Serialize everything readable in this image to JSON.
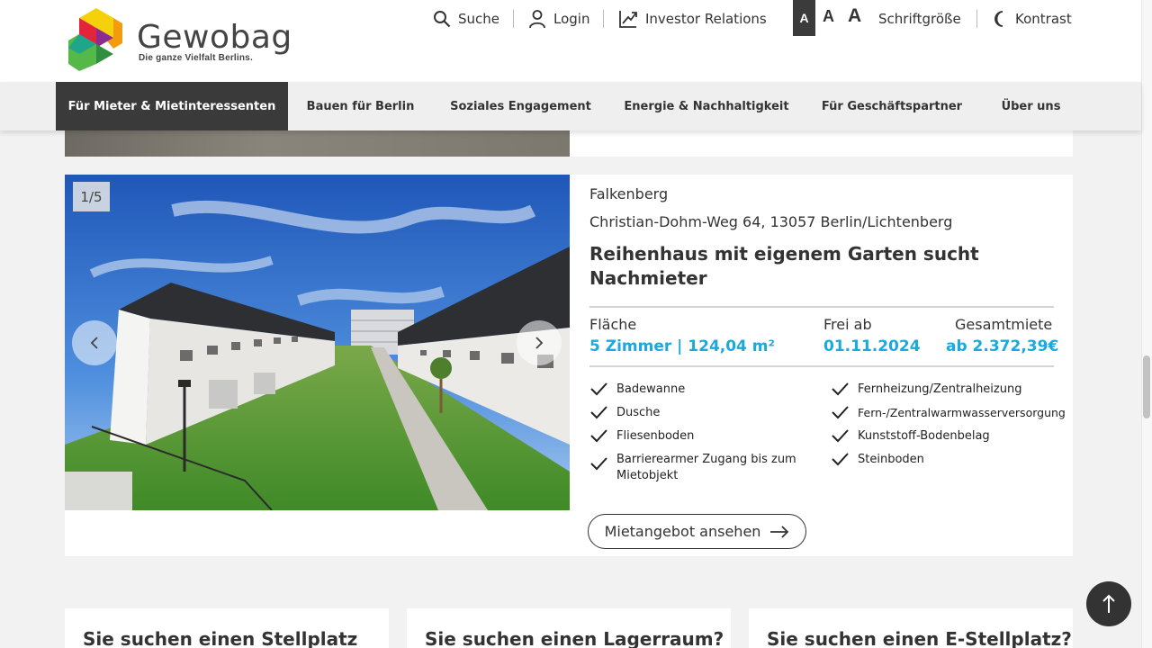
{
  "brand": {
    "name": "Gewobag",
    "tagline": "Die ganze Vielfalt Berlins."
  },
  "utility": {
    "search": "Suche",
    "login": "Login",
    "investor": "Investor Relations",
    "font_sizes": [
      "A",
      "A",
      "A"
    ],
    "font_size_label": "Schriftgröße",
    "contrast": "Kontrast"
  },
  "nav": [
    {
      "label": "Für Mieter & Mietinteressenten",
      "active": true
    },
    {
      "label": "Bauen für Berlin"
    },
    {
      "label": "Soziales Engagement"
    },
    {
      "label": "Energie & Nachhaltigkeit"
    },
    {
      "label": "Für Geschäftspartner"
    },
    {
      "label": "Über uns"
    }
  ],
  "listing": {
    "image_counter": "1/5",
    "district": "Falkenberg",
    "address": "Christian-Dohm-Weg 64, 13057 Berlin/Lichtenberg",
    "title": "Reihenhaus mit eigenem Garten sucht Nachmieter",
    "facts": {
      "area_label": "Fläche",
      "area_value": "5 Zimmer | 124,04 m²",
      "available_label": "Frei ab",
      "available_value": "01.11.2024",
      "rent_label": "Gesamtmiete",
      "rent_value": "ab 2.372,39€"
    },
    "features_left": [
      "Badewanne",
      "Dusche",
      "Fliesenboden",
      "Barrierearmer Zugang bis zum Mietobjekt"
    ],
    "features_right": [
      "Fernheizung/Zentralheizung",
      "Fern-/Zentralwarmwasserversorgung",
      "Kunststoff-Bodenbelag",
      "Steinboden"
    ],
    "cta": "Mietangebot ansehen"
  },
  "teasers": [
    "Sie suchen einen Stellplatz",
    "Sie suchen einen Lagerraum?",
    "Sie suchen einen E-Stellplatz?"
  ],
  "colors": {
    "accent": "#1aa9df",
    "dark": "#3a3a3a"
  }
}
